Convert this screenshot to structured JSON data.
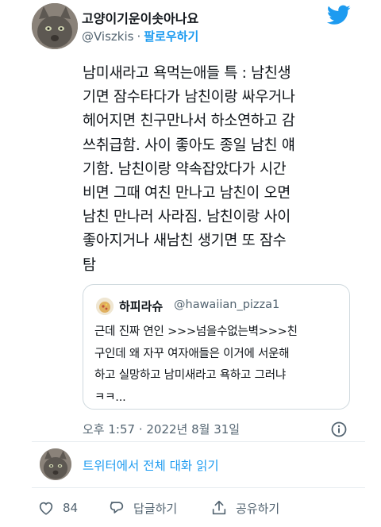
{
  "author": {
    "display_name": "고양이기운이솟아나요",
    "handle": "@Viszkis",
    "separator": "·",
    "follow_label": "팔로우하기"
  },
  "tweet": {
    "text": "남미새라고 욕먹는애들 특 : 남친생\n기면 잠수타다가 남친이랑 싸우거나\n헤어지면 친구만나서 하소연하고 감\n쓰취급함. 사이 좋아도 종일 남친 얘\n기함. 남친이랑 약속잡았다가 시간\n비면 그때 여친 만나고 남친이 오면\n남친 만나러 사라짐. 남친이랑 사이\n좋아지거나 새남친 생기면 또 잠수\n탐"
  },
  "quoted_tweet": {
    "display_name": "하피라슈",
    "handle": "@hawaiian_pizza1",
    "text": "근데 진짜 연인 >>>넘을수없는벽>>>친\n구인데 왜 자꾸 여자애들은 이거에 서운해\n하고 실망하고 남미새라고 욕하고 그러냐\nㅋㅋ..."
  },
  "meta": {
    "timestamp": "오후 1:57 · 2022년 8월 31일"
  },
  "thread": {
    "read_label": "트위터에서 전체 대화 읽기"
  },
  "actions": {
    "like_count": "84",
    "reply_label": "답글하기",
    "share_label": "공유하기"
  },
  "icons": {
    "twitter": "twitter-bird-icon",
    "info": "info-icon",
    "like": "heart-icon",
    "reply": "reply-bubble-icon",
    "share": "share-upload-icon"
  },
  "colors": {
    "accent": "#1d9bf0",
    "secondary_text": "#536471",
    "border": "#cfd9de"
  }
}
